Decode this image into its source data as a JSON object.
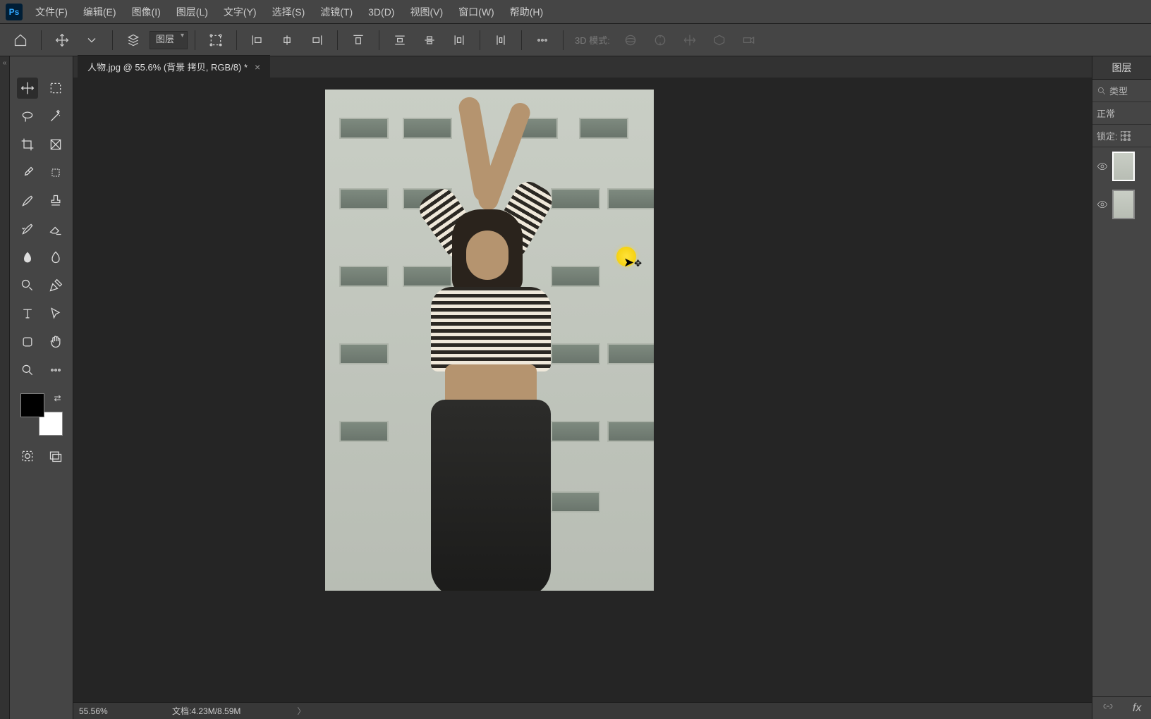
{
  "menu": {
    "file": "文件(F)",
    "edit": "编辑(E)",
    "image": "图像(I)",
    "layer": "图层(L)",
    "type": "文字(Y)",
    "select": "选择(S)",
    "filter": "滤镜(T)",
    "threeD": "3D(D)",
    "view": "视图(V)",
    "window": "窗口(W)",
    "help": "帮助(H)"
  },
  "options": {
    "auto_select_dropdown": "图层",
    "threeD_mode_label": "3D 模式:"
  },
  "document": {
    "tab_title": "人物.jpg @ 55.6% (背景 拷贝, RGB/8) *"
  },
  "status": {
    "zoom": "55.56%",
    "doc_label": "文档:",
    "doc_value": "4.23M/8.59M"
  },
  "panels": {
    "layers_tab": "图层",
    "filter_label": "类型",
    "blend_mode": "正常",
    "lock_label": "锁定:"
  }
}
